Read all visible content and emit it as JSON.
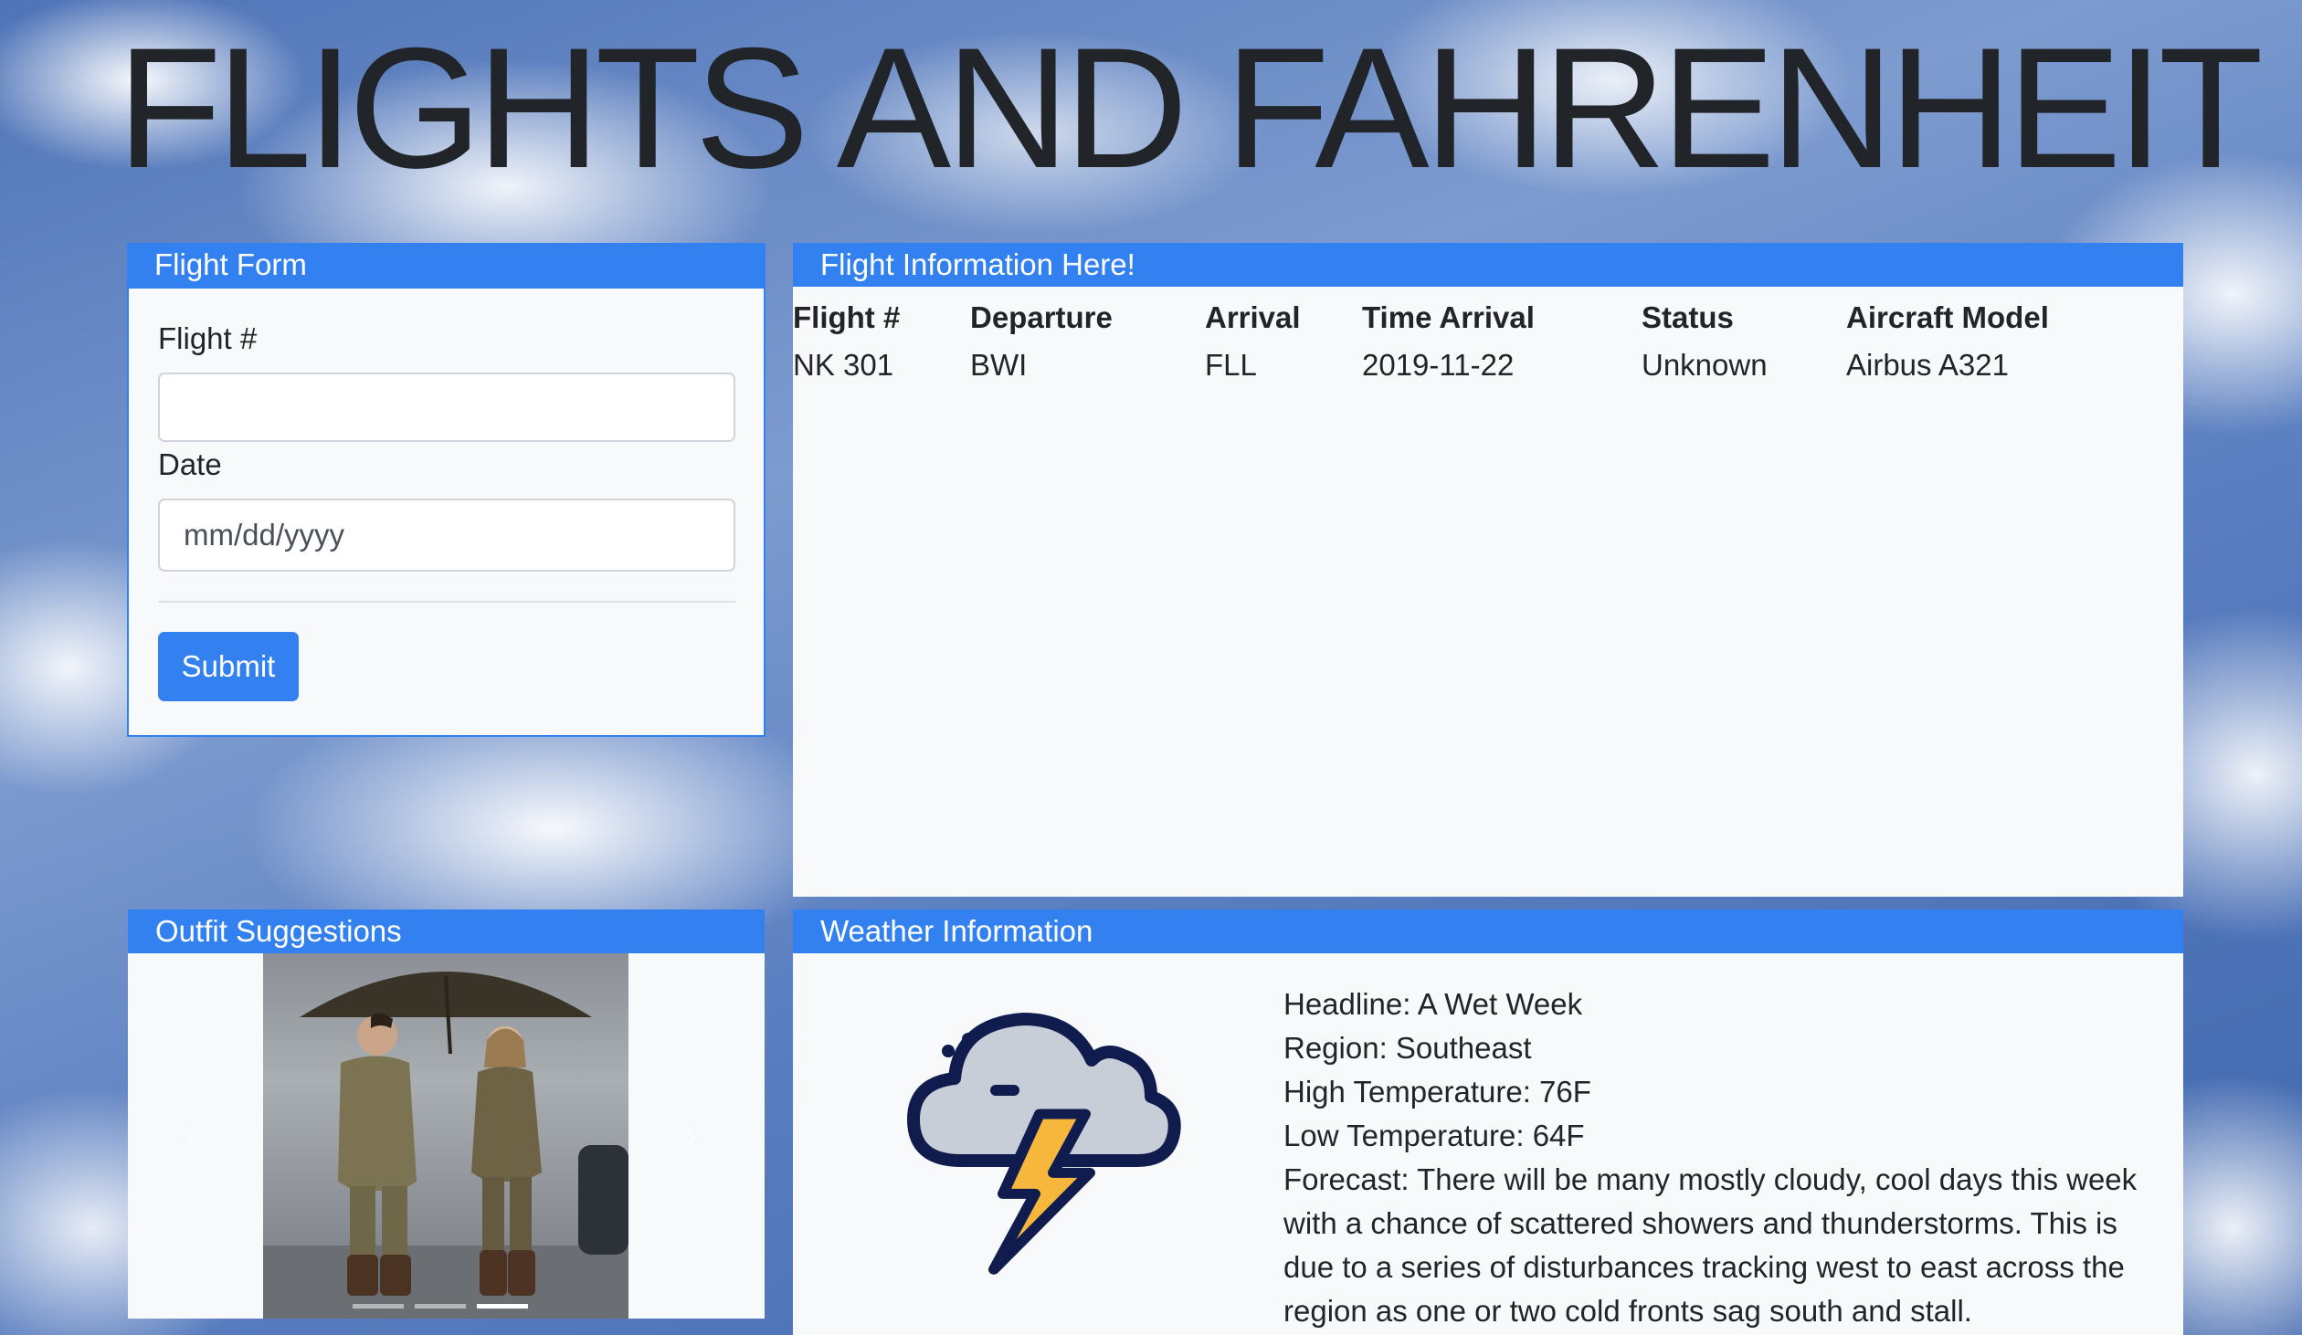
{
  "page": {
    "title": "FLIGHTS AND FAHRENHEIT"
  },
  "flight_form": {
    "header": "Flight Form",
    "flight_label": "Flight #",
    "flight_value": "",
    "date_label": "Date",
    "date_placeholder": "mm/dd/yyyy",
    "submit_label": "Submit"
  },
  "flight_info": {
    "header": "Flight Information Here!",
    "columns": [
      "Flight #",
      "Departure",
      "Arrival",
      "Time Arrival",
      "Status",
      "Aircraft Model"
    ],
    "rows": [
      [
        "NK 301",
        "BWI",
        "FLL",
        "2019-11-22",
        "Unknown",
        "Airbus A321"
      ]
    ]
  },
  "outfit": {
    "header": "Outfit Suggestions",
    "slide_count": 3,
    "active_slide": 3
  },
  "weather": {
    "header": "Weather Information",
    "icon": "thunderstorm-cloud-icon",
    "headline": "Headline: A Wet Week",
    "region": "Region: Southeast",
    "high": "High Temperature: 76F",
    "low": "Low Temperature: 64F",
    "forecast": "Forecast: There will be many mostly cloudy, cool days this week with a chance of scattered showers and thunderstorms. This is due to a series of disturbances tracking west to east across the region as one or two cold fronts sag south and stall."
  },
  "colors": {
    "accent": "#3381f0",
    "card_bg": "#f8f9fa",
    "text": "#212529"
  }
}
